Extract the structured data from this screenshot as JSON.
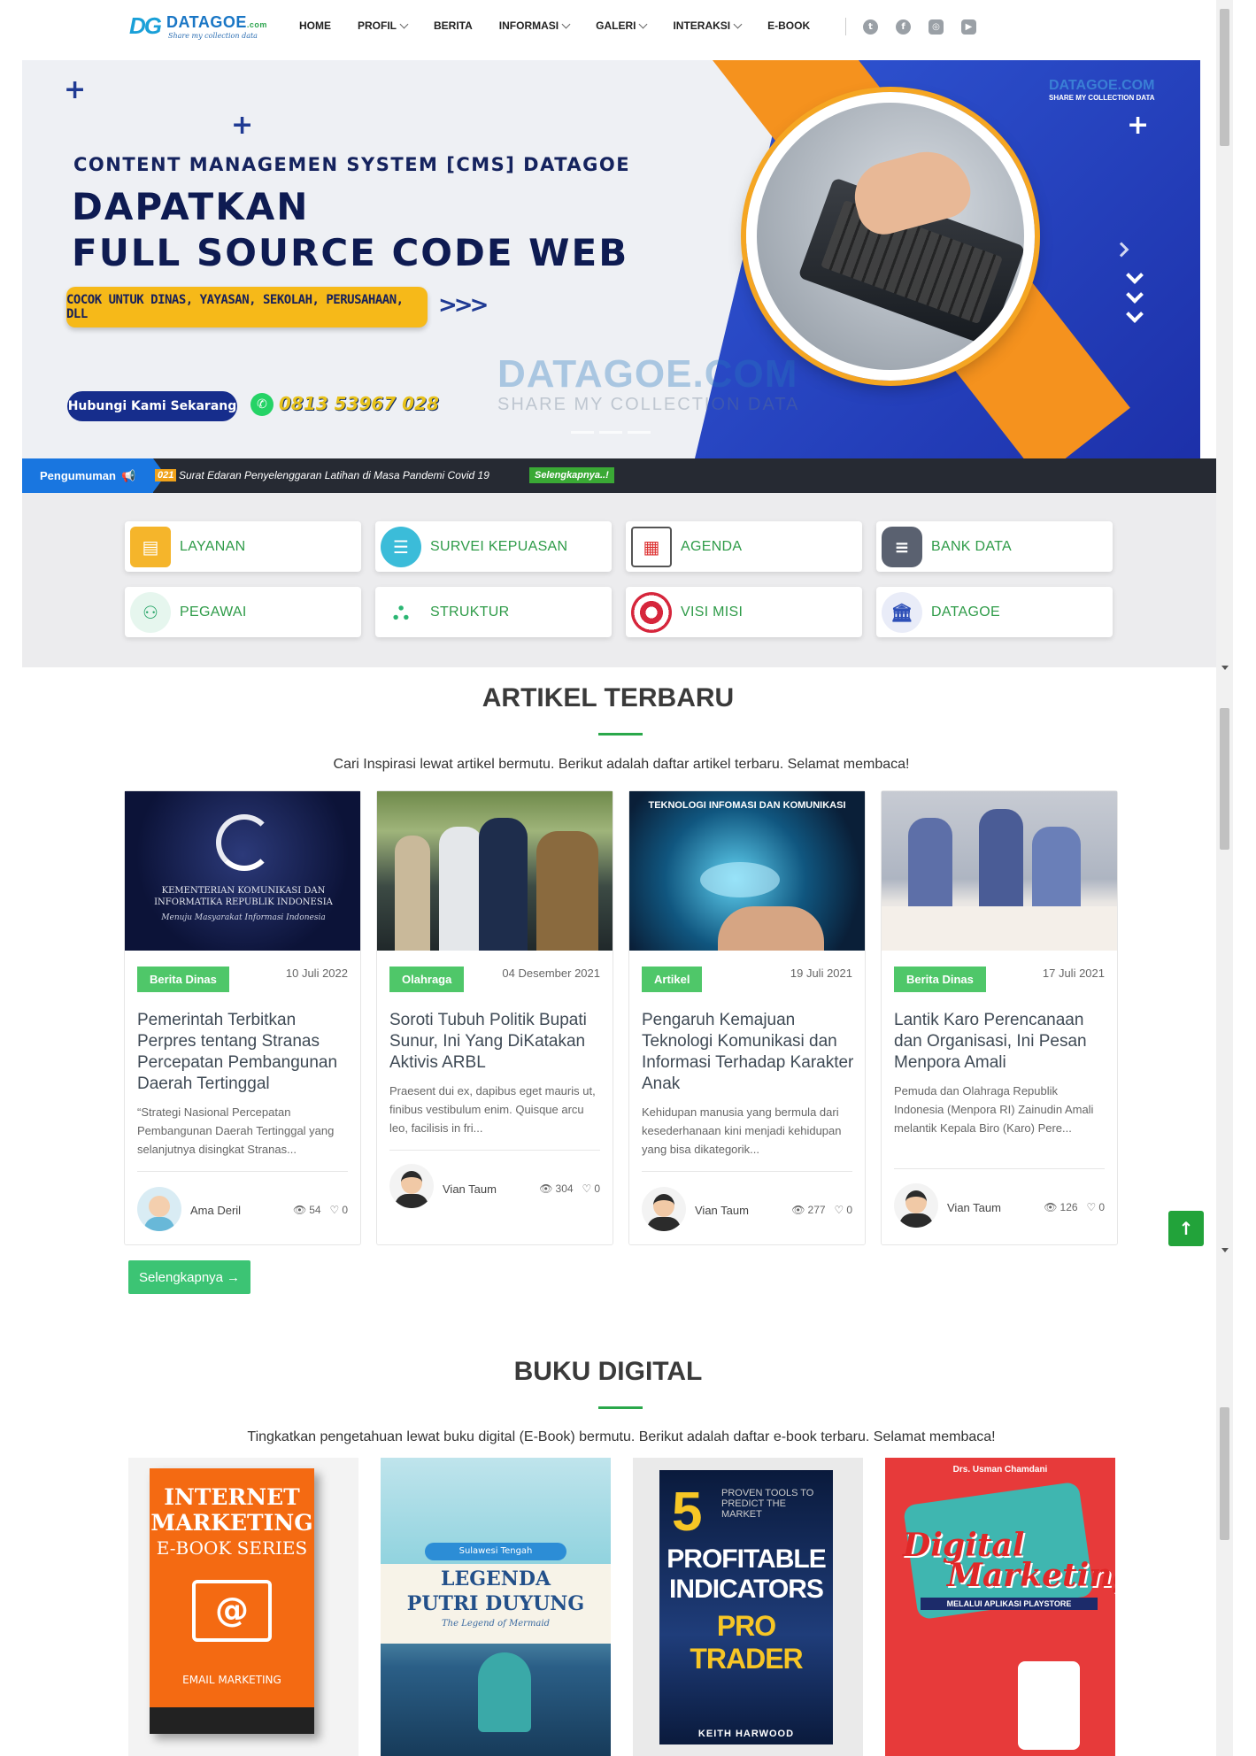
{
  "nav": {
    "logo_mark": "DG",
    "logo_name": "DATAGOE",
    "logo_suffix": ".com",
    "logo_tagline": "Share my collection data",
    "items": [
      {
        "label": "HOME",
        "dropdown": false
      },
      {
        "label": "PROFIL",
        "dropdown": true
      },
      {
        "label": "BERITA",
        "dropdown": false
      },
      {
        "label": "INFORMASI",
        "dropdown": true
      },
      {
        "label": "GALERI",
        "dropdown": true
      },
      {
        "label": "INTERAKSI",
        "dropdown": true
      },
      {
        "label": "E-BOOK",
        "dropdown": false
      }
    ],
    "social_icons": [
      "twitter-icon",
      "facebook-icon",
      "instagram-icon",
      "youtube-icon"
    ]
  },
  "hero": {
    "subtitle": "CONTENT MANAGEMEN SYSTEM [CMS] DATAGOE",
    "title_line1": "DAPATKAN",
    "title_line2": "FULL SOURCE CODE WEB",
    "pill": "COCOK UNTUK DINAS, YAYASAN, SEKOLAH, PERUSAHAAN, DLL",
    "contact_button": "Hubungi Kami Sekarang",
    "phone": "0813 53967 028",
    "watermark": "DATAGOE.COM",
    "watermark_sub": "SHARE MY COLLECTION DATA",
    "brand": "DATAGOE.COM",
    "brand_sub": "SHARE MY COLLECTION DATA"
  },
  "announcement": {
    "label": "Pengumuman",
    "date_fragment": "021",
    "text": "Surat Edaran Penyelenggaran Latihan di Masa Pandemi Covid 19",
    "more": "Selengkapnya..!"
  },
  "services": [
    {
      "label": "LAYANAN",
      "icon": "drawer-icon",
      "color": "#f5b52b"
    },
    {
      "label": "SURVEI KEPUASAN",
      "icon": "survey-icon",
      "color": "#3bbcd9"
    },
    {
      "label": "AGENDA",
      "icon": "calendar-icon",
      "color": "#e0e0e0"
    },
    {
      "label": "BANK DATA",
      "icon": "database-icon",
      "color": "#5a6170"
    },
    {
      "label": "PEGAWAI",
      "icon": "people-icon",
      "color": "#e6f6ee"
    },
    {
      "label": "STRUKTUR",
      "icon": "hierarchy-icon",
      "color": "#2bb673"
    },
    {
      "label": "VISI MISI",
      "icon": "target-icon",
      "color": "#d6263c"
    },
    {
      "label": "DATAGOE",
      "icon": "building-icon",
      "color": "#2e50b8"
    }
  ],
  "articles_section": {
    "title": "ARTIKEL TERBARU",
    "subtitle": "Cari Inspirasi lewat artikel bermutu. Berikut adalah daftar artikel terbaru. Selamat membaca!",
    "more_button": "Selengkapnya"
  },
  "articles": [
    {
      "category": "Berita Dinas",
      "date": "10 Juli 2022",
      "title": "Pemerintah Terbitkan Perpres tentang Stranas Percepatan Pembangunan Daerah Tertinggal",
      "excerpt": "“Strategi Nasional Percepatan Pembangunan Daerah Tertinggal yang selanjutnya disingkat Stranas...",
      "author": "Ama Deril",
      "views": "54",
      "likes": "0",
      "image_caption": "KEMENTERIAN KOMUNIKASI DAN INFORMATIKA REPUBLIK INDONESIA",
      "image_motto": "Menuju Masyarakat Informasi Indonesia"
    },
    {
      "category": "Olahraga",
      "date": "04 Desember 2021",
      "title": "Soroti Tubuh Politik Bupati Sunur, Ini Yang DiKatakan Aktivis ARBL",
      "excerpt": "Praesent dui ex, dapibus eget mauris ut, finibus vestibulum enim. Quisque arcu leo, facilisis in fri...",
      "author": "Vian Taum",
      "views": "304",
      "likes": "0"
    },
    {
      "category": "Artikel",
      "date": "19 Juli 2021",
      "title": "Pengaruh Kemajuan Teknologi Komunikasi dan Informasi Terhadap Karakter Anak",
      "excerpt": "Kehidupan manusia yang bermula dari kesederhanaan kini menjadi kehidupan yang bisa dikategorik...",
      "author": "Vian Taum",
      "views": "277",
      "likes": "0",
      "image_caption": "TEKNOLOGI INFOMASI DAN KOMUNIKASI"
    },
    {
      "category": "Berita Dinas",
      "date": "17 Juli 2021",
      "title": "Lantik Karo Perencanaan dan Organisasi, Ini Pesan Menpora Amali",
      "excerpt": "Pemuda dan Olahraga Republik Indonesia (Menpora RI) Zainudin Amali melantik Kepala Biro (Karo) Pere...",
      "author": "Vian Taum",
      "views": "126",
      "likes": "0"
    }
  ],
  "books_section": {
    "title": "BUKU DIGITAL",
    "subtitle": "Tingkatkan pengetahuan lewat buku digital (E-Book) bermutu. Berikut adalah daftar e-book terbaru. Selamat membaca!"
  },
  "books": [
    {
      "line1": "INTERNET",
      "line2": "MARKETING",
      "line3": "E-BOOK SERIES",
      "footer": "EMAIL MARKETING"
    },
    {
      "top": "Sulawesi Tengah",
      "line1": "LEGENDA",
      "line2": "PUTRI DUYUNG",
      "line3": "The Legend of Mermaid"
    },
    {
      "big": "5",
      "small": "PROVEN TOOLS TO PREDICT THE MARKET",
      "line1": "PROFITABLE",
      "line2": "INDICATORS",
      "line3": "PRO TRADER",
      "author": "KEITH HARWOOD"
    },
    {
      "author": "Drs. Usman Chamdani",
      "line1": "Digital",
      "line2": "Marketing",
      "line3": "MELALUI APLIKASI PLAYSTORE"
    }
  ]
}
